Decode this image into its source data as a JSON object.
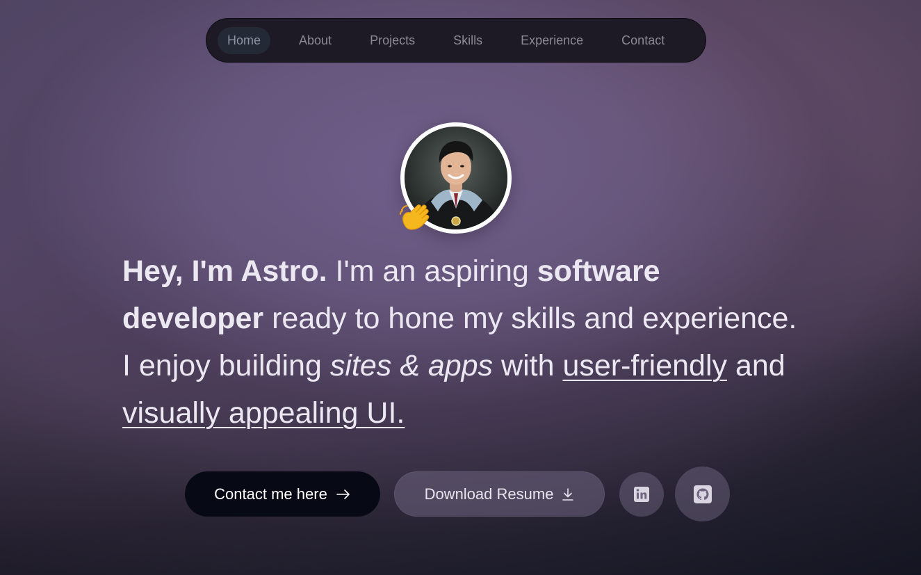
{
  "nav": {
    "items": [
      {
        "label": "Home",
        "active": true
      },
      {
        "label": "About",
        "active": false
      },
      {
        "label": "Projects",
        "active": false
      },
      {
        "label": "Skills",
        "active": false
      },
      {
        "label": "Experience",
        "active": false
      },
      {
        "label": "Contact",
        "active": false
      }
    ]
  },
  "hero": {
    "avatar_icon": "profile-photo",
    "wave_icon": "waving-hand-emoji",
    "headline": {
      "greeting": "Hey, I'm Astro.",
      "part1": " I'm an aspiring ",
      "role": "software developer",
      "part2": " ready to hone my skills and experience. I enjoy building ",
      "focus": "sites & apps",
      "part3": " with ",
      "quality1": "user-friendly",
      "part4": " and ",
      "quality2": "visually appealing UI."
    }
  },
  "actions": {
    "contact_label": "Contact me here",
    "contact_icon": "arrow-right-icon",
    "resume_label": "Download Resume",
    "resume_icon": "download-icon",
    "linkedin_icon": "linkedin-icon",
    "github_icon": "github-icon"
  },
  "colors": {
    "contact_button_bg": "#070a14",
    "nav_bg": "#1d1a26",
    "text": "#ece8f2"
  }
}
